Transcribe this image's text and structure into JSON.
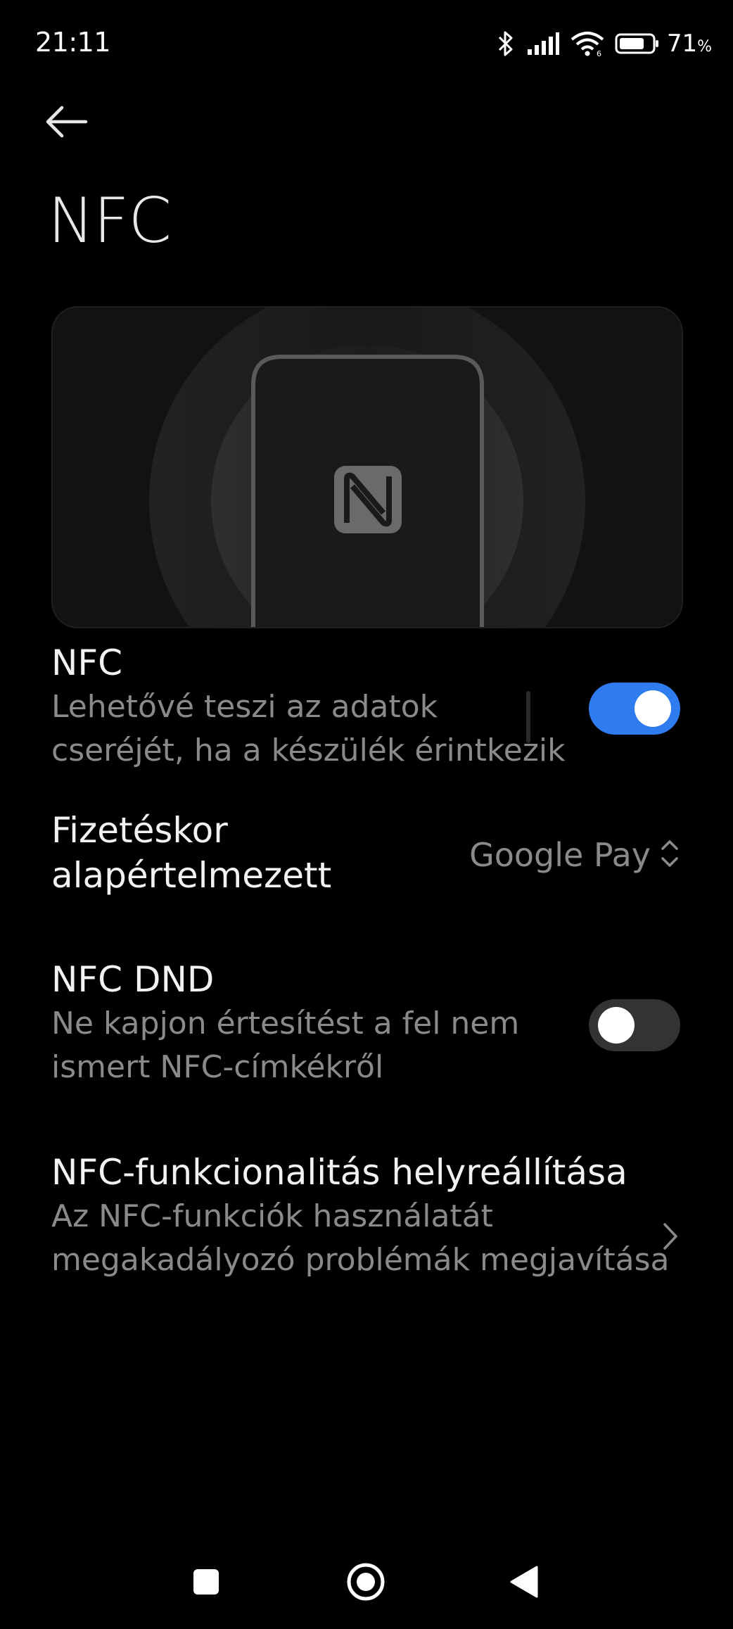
{
  "status_bar": {
    "time": "21:11",
    "battery_percent": "71",
    "battery_unit": "%",
    "icons": [
      "bluetooth-icon",
      "signal-icon",
      "wifi-icon",
      "battery-icon"
    ]
  },
  "header": {
    "title": "NFC"
  },
  "settings": {
    "nfc": {
      "title": "NFC",
      "description_line1": "Lehetővé teszi az adatok",
      "description_line2": "cseréjét, ha a készülék érintkezik",
      "enabled": true
    },
    "payment_default": {
      "title_line1": "Fizetéskor",
      "title_line2": "alapértelmezett",
      "value": "Google Pay"
    },
    "nfc_dnd": {
      "title": "NFC DND",
      "description_line1": "Ne kapjon értesítést a fel nem",
      "description_line2": "ismert NFC-címkékről",
      "enabled": false
    },
    "nfc_restore": {
      "title": "NFC-funkcionalitás helyreállítása",
      "description_line1": "Az NFC-funkciók használatát",
      "description_line2": "megakadályozó problémák megjavítása"
    }
  },
  "colors": {
    "accent": "#2f7bf0",
    "background": "#000000",
    "secondary_text": "#8a8a8a"
  },
  "nav_bar": {
    "buttons": [
      "recents-icon",
      "home-icon",
      "back-triangle-icon"
    ]
  }
}
